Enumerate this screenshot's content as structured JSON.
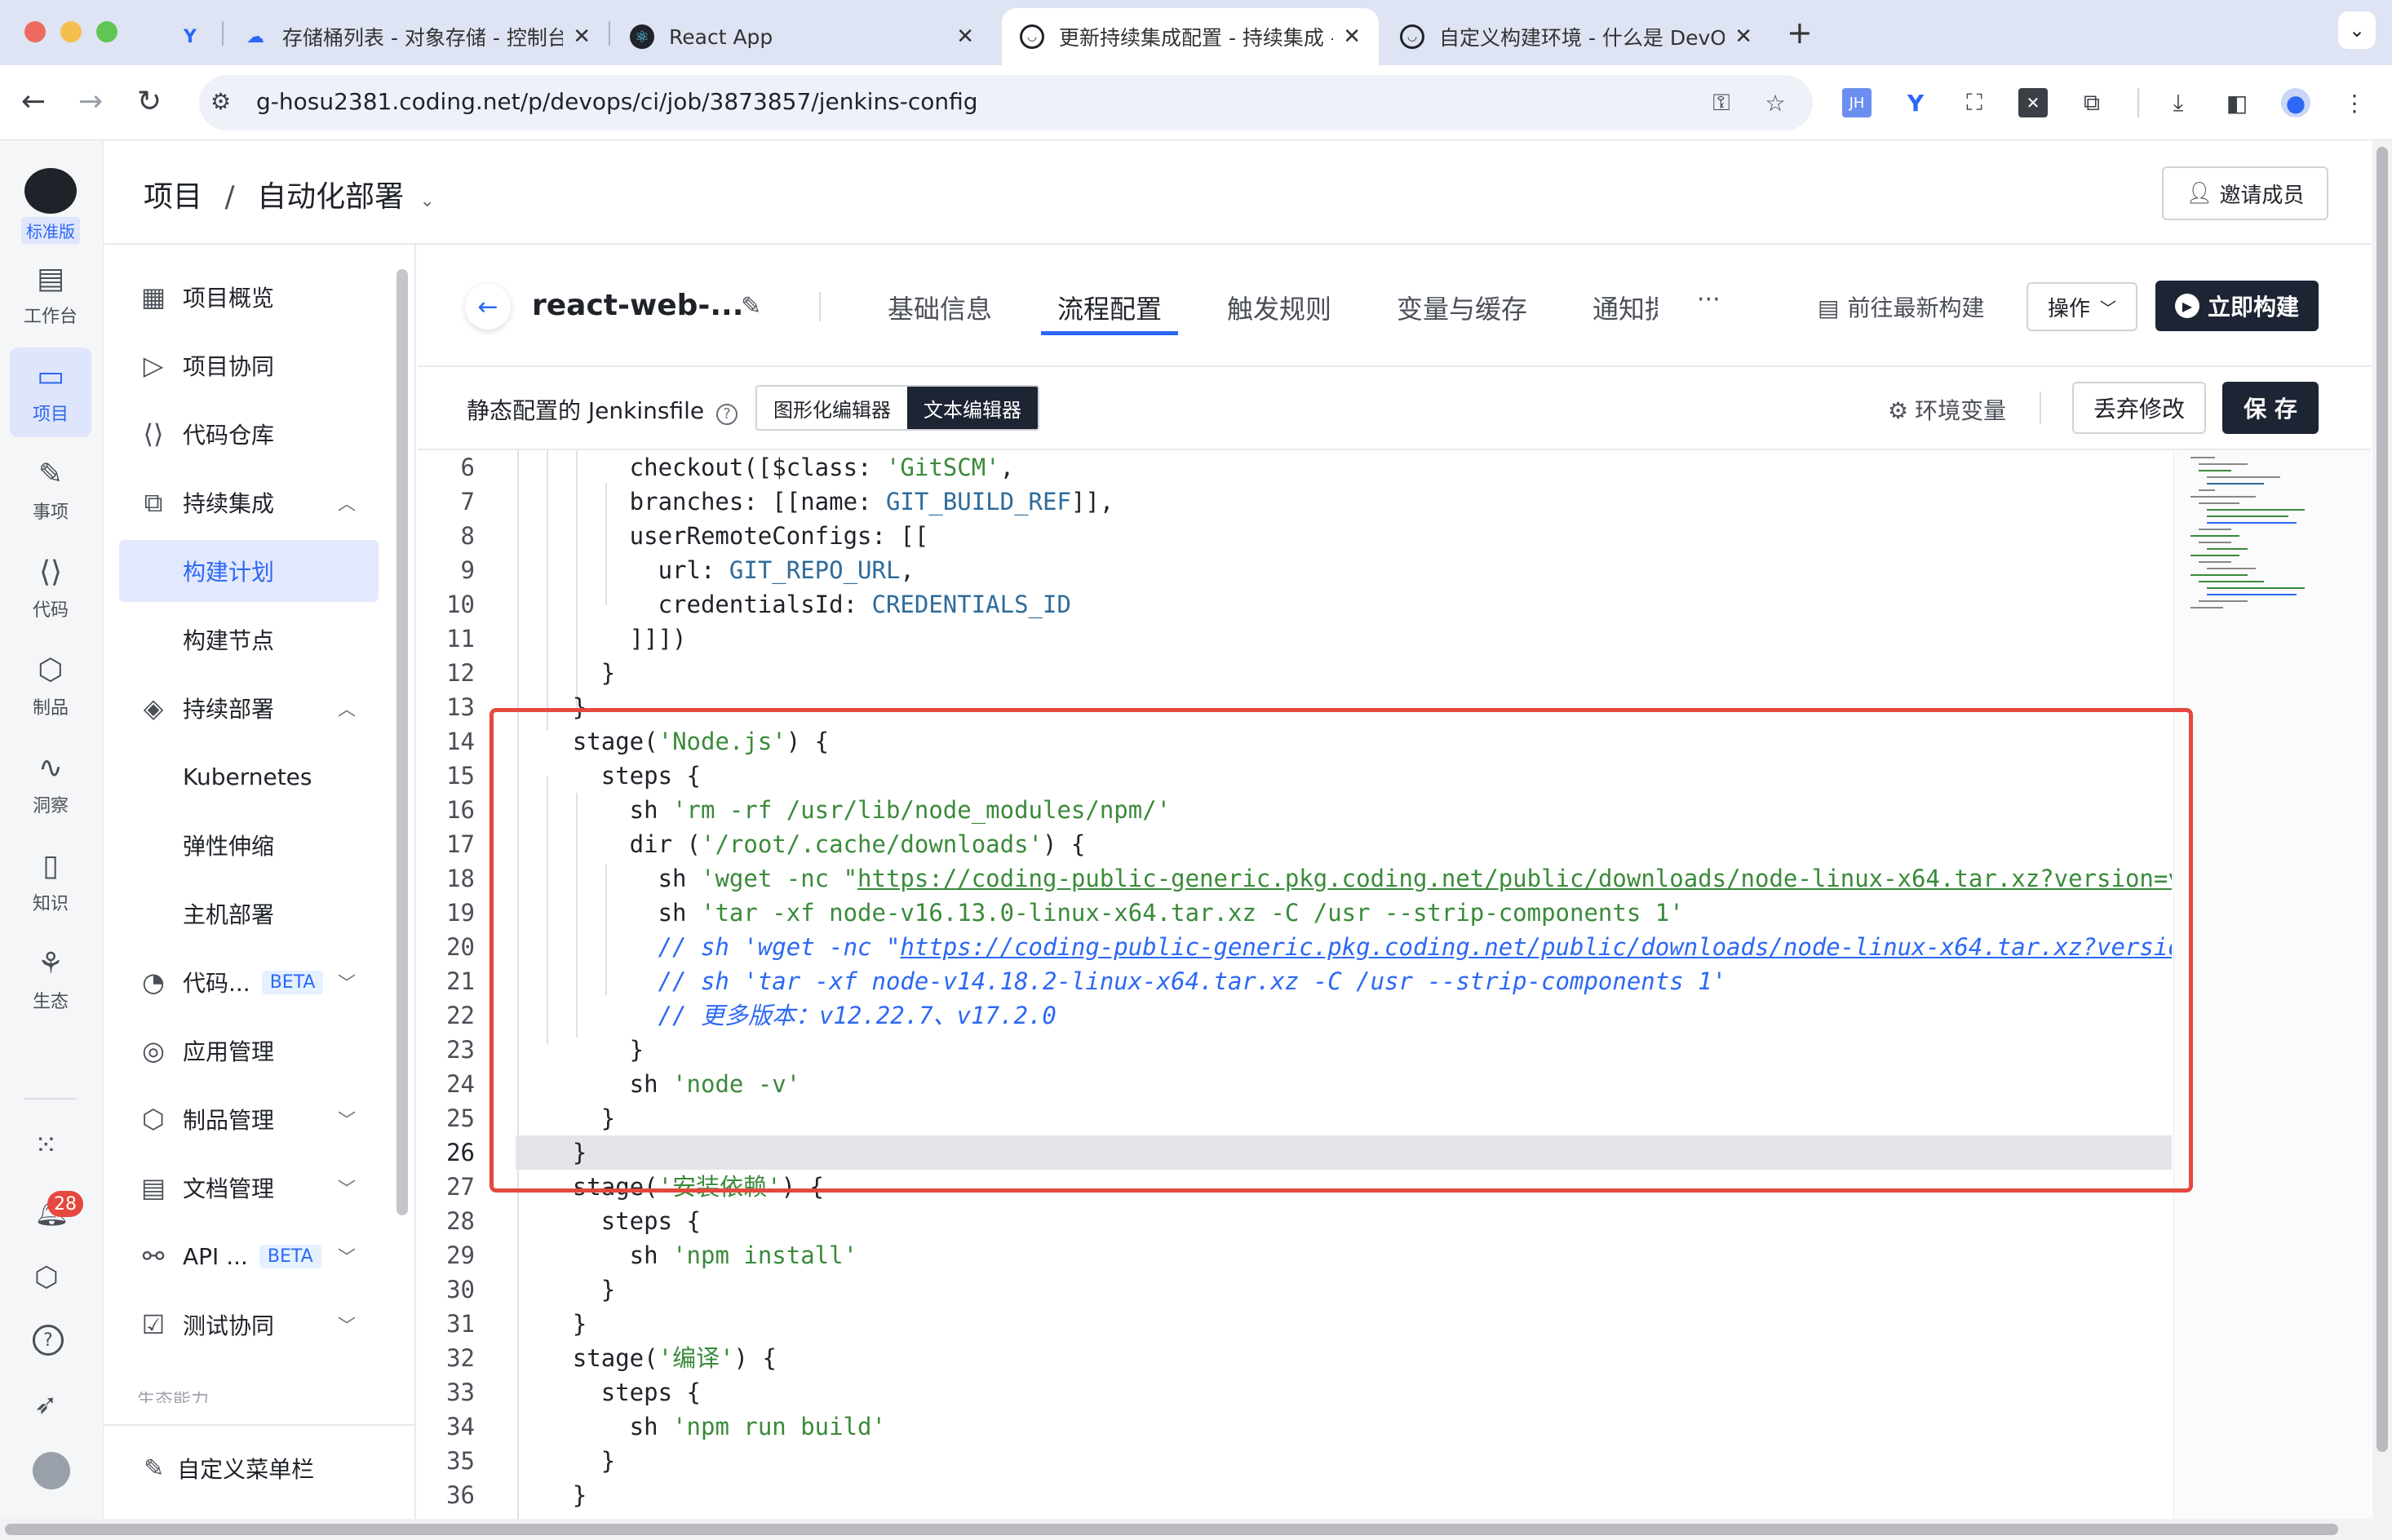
{
  "browser": {
    "tabs": [
      {
        "title": ""
      },
      {
        "title": "存储桶列表 - 对象存储 - 控制台"
      },
      {
        "title": "React App"
      },
      {
        "title": "更新持续集成配置 - 持续集成 -"
      },
      {
        "title": "自定义构建环境 - 什么是 DevOps"
      }
    ],
    "url": "g-hosu2381.coding.net/p/devops/ci/job/3873857/jenkins-config"
  },
  "rail": {
    "edition": "标准版",
    "items": [
      "工作台",
      "项目",
      "事项",
      "代码",
      "制品",
      "洞察",
      "知识",
      "生态"
    ],
    "notification_count": "28"
  },
  "header": {
    "crumb_root": "项目",
    "crumb_sep": "/",
    "crumb_project": "自动化部署",
    "invite_label": "邀请成员"
  },
  "sidebar": {
    "items": [
      {
        "label": "项目概览"
      },
      {
        "label": "项目协同"
      },
      {
        "label": "代码仓库"
      },
      {
        "label": "持续集成"
      },
      {
        "label": "构建计划"
      },
      {
        "label": "构建节点"
      },
      {
        "label": "持续部署"
      },
      {
        "label": "Kubernetes"
      },
      {
        "label": "弹性伸缩"
      },
      {
        "label": "主机部署"
      },
      {
        "label": "代码..."
      },
      {
        "label": "应用管理"
      },
      {
        "label": "制品管理"
      },
      {
        "label": "文档管理"
      },
      {
        "label": "API ..."
      },
      {
        "label": "测试协同"
      }
    ],
    "beta": "BETA",
    "section_hint": "生态能力",
    "custom_menu": "自定义菜单栏"
  },
  "job": {
    "name": "react-web-...",
    "tabs": [
      "基础信息",
      "流程配置",
      "触发规则",
      "变量与缓存",
      "通知提"
    ],
    "more": "···",
    "latest_build": "前往最新构建",
    "ops": "操作",
    "build_now": "立即构建"
  },
  "editor_bar": {
    "static_label": "静态配置的 Jenkinsfile",
    "graphic_editor": "图形化编辑器",
    "text_editor": "文本编辑器",
    "env_vars": "环境变量",
    "discard": "丢弃修改",
    "save": "保 存"
  },
  "code": {
    "line_numbers": [
      "6",
      "7",
      "8",
      "9",
      "10",
      "11",
      "12",
      "13",
      "14",
      "15",
      "16",
      "17",
      "18",
      "19",
      "20",
      "21",
      "22",
      "23",
      "24",
      "25",
      "26",
      "27",
      "28",
      "29",
      "30",
      "31",
      "32",
      "33",
      "34",
      "35",
      "36"
    ],
    "current_line": "26"
  }
}
